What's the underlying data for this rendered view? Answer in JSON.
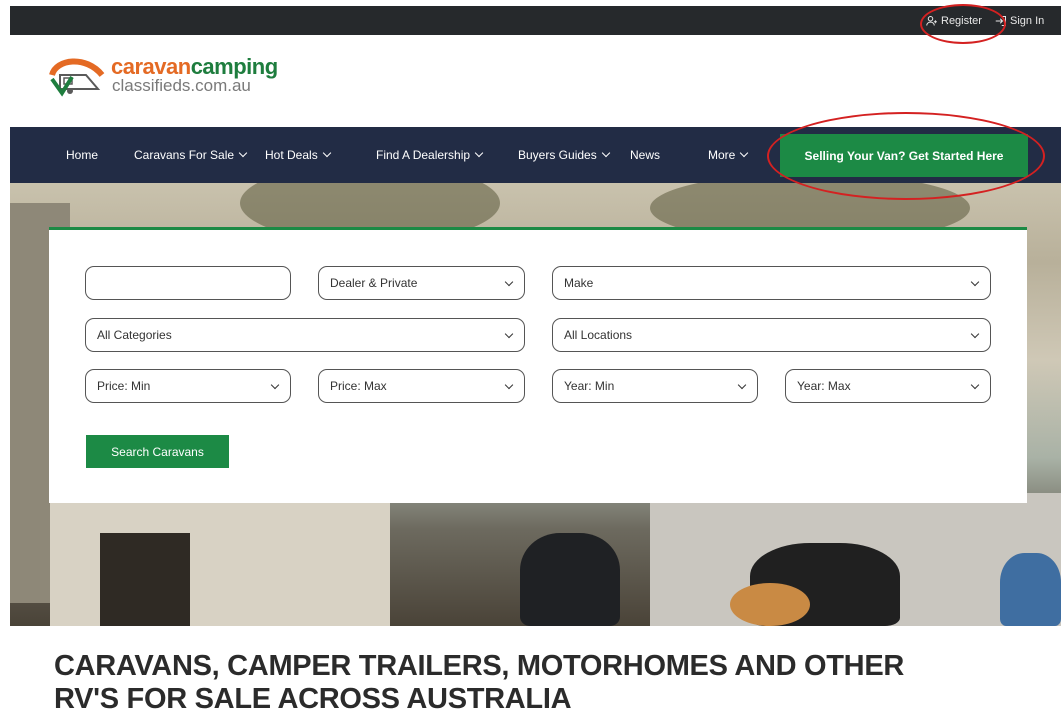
{
  "topbar": {
    "register_label": "Register",
    "signin_label": "Sign In",
    "register_icon": "user-plus-icon",
    "signin_icon": "sign-in-icon"
  },
  "logo": {
    "brand_part1": "caravan",
    "brand_part2": "camping",
    "domain": "classifieds.com.au"
  },
  "nav": {
    "items": [
      {
        "label": "Home"
      },
      {
        "label": "Caravans For Sale"
      },
      {
        "label": "Hot Deals"
      },
      {
        "label": "Find A Dealership"
      },
      {
        "label": "Buyers Guides"
      },
      {
        "label": "News"
      },
      {
        "label": "More"
      }
    ],
    "cta_label": "Selling Your Van? Get Started Here"
  },
  "search": {
    "keyword_value": "",
    "seller_type": "Dealer & Private",
    "make": "Make",
    "category": "All Categories",
    "location": "All Locations",
    "price_min": "Price: Min",
    "price_max": "Price: Max",
    "year_min": "Year: Min",
    "year_max": "Year: Max",
    "button_label": "Search Caravans"
  },
  "headline": {
    "line1": "CARAVANS, CAMPER TRAILERS, MOTORHOMES AND OTHER",
    "line2": "RV'S FOR SALE ACROSS AUSTRALIA"
  },
  "colors": {
    "nav_bg": "#222c45",
    "topbar_bg": "#26292c",
    "accent_green": "#1c8a45",
    "brand_orange": "#e46a24",
    "annotation_red": "#d42121"
  }
}
